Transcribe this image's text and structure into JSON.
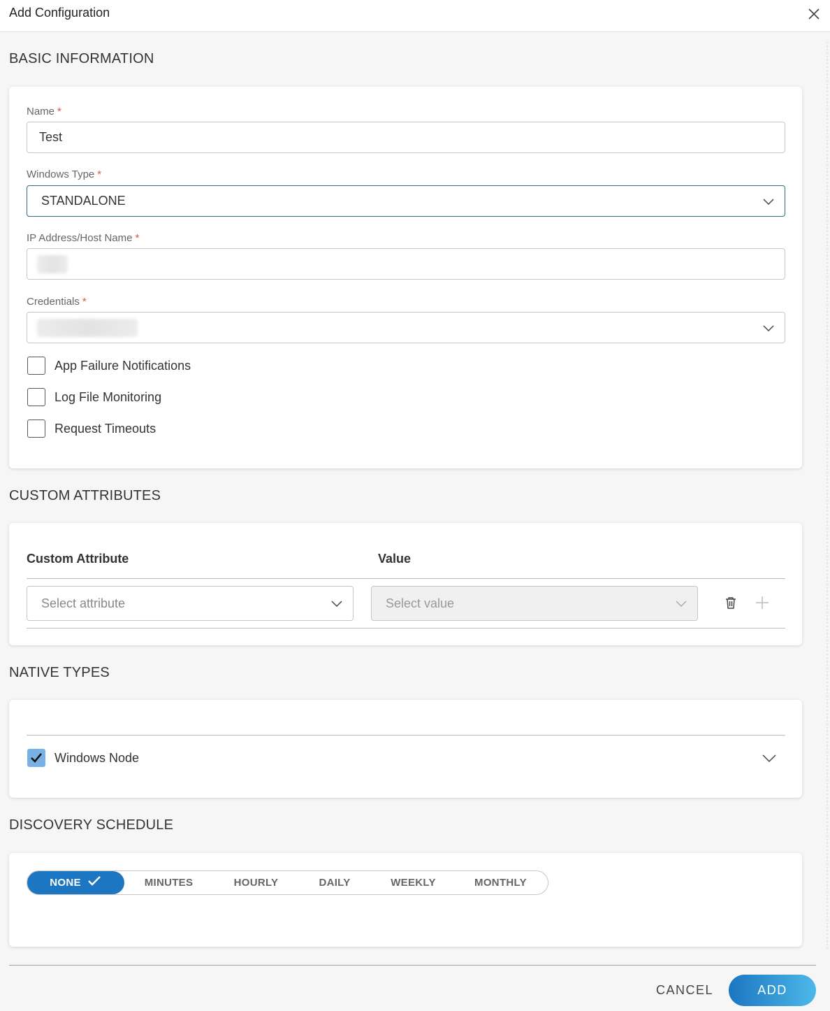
{
  "dialog": {
    "title": "Add Configuration"
  },
  "basic": {
    "section_title": "BASIC INFORMATION",
    "name": {
      "label": "Name",
      "value": "Test"
    },
    "windows_type": {
      "label": "Windows Type",
      "value": "STANDALONE"
    },
    "ip": {
      "label": "IP Address/Host Name"
    },
    "credentials": {
      "label": "Credentials"
    },
    "required_mark": "*",
    "options": [
      {
        "label": "App Failure Notifications",
        "checked": false
      },
      {
        "label": "Log File Monitoring",
        "checked": false
      },
      {
        "label": "Request Timeouts",
        "checked": false
      }
    ]
  },
  "custom": {
    "section_title": "CUSTOM ATTRIBUTES",
    "col_attribute": "Custom Attribute",
    "col_value": "Value",
    "attribute_placeholder": "Select attribute",
    "value_placeholder": "Select value"
  },
  "native": {
    "section_title": "NATIVE TYPES",
    "item": {
      "label": "Windows Node",
      "checked": true
    }
  },
  "schedule": {
    "section_title": "DISCOVERY SCHEDULE",
    "options": [
      "NONE",
      "MINUTES",
      "HOURLY",
      "DAILY",
      "WEEKLY",
      "MONTHLY"
    ],
    "selected": "NONE"
  },
  "footer": {
    "cancel": "CANCEL",
    "add": "ADD"
  },
  "colors": {
    "accent": "#1c76c1",
    "required": "#d9534f",
    "checkbox_checked": "#7ab1e5"
  }
}
